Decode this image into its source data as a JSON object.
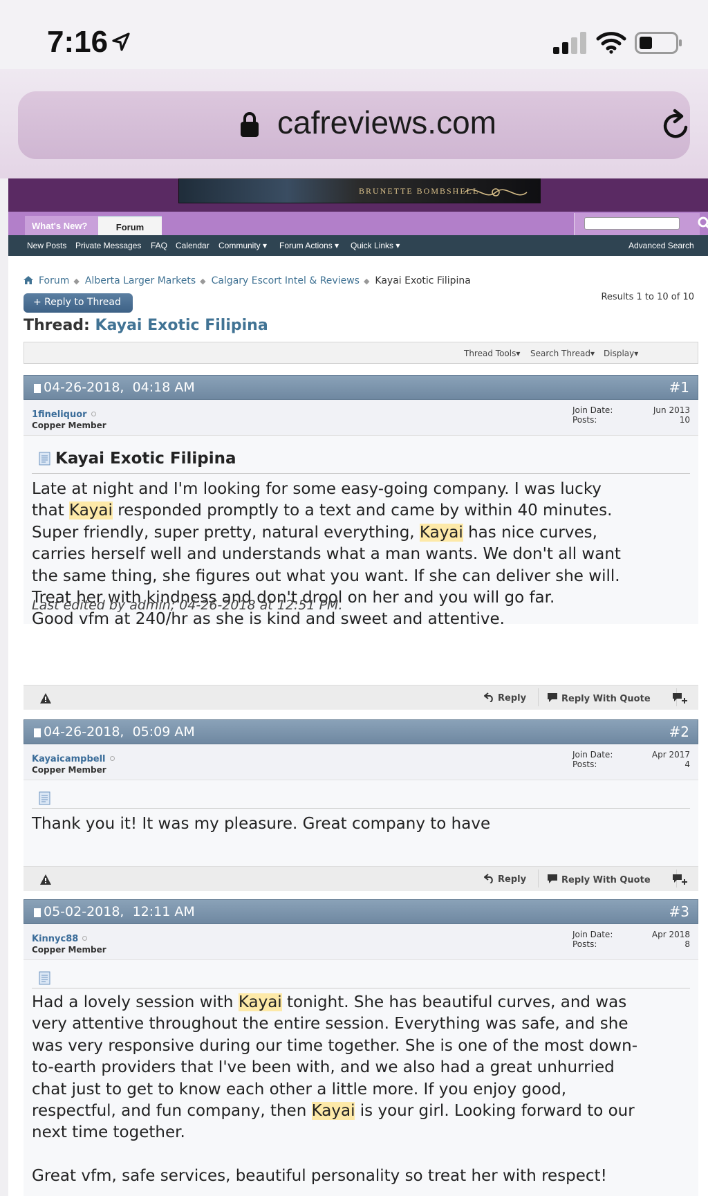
{
  "status_bar": {
    "time": "7:16",
    "icons": [
      "location-arrow-icon",
      "cellular-signal-icon",
      "wifi-icon",
      "battery-icon"
    ]
  },
  "browser": {
    "url": "cafreviews.com",
    "icons": [
      "lock-icon",
      "reload-icon"
    ]
  },
  "banner": {
    "text": "BRUNETTE BOMBSHELL"
  },
  "navbar": {
    "tabs": [
      {
        "label": "What's New?",
        "active": false
      },
      {
        "label": "Forum",
        "active": true
      }
    ],
    "search_placeholder": ""
  },
  "subnav": {
    "items": [
      "New Posts",
      "Private Messages",
      "FAQ",
      "Calendar",
      "Community ▾",
      "Forum Actions ▾",
      "Quick Links ▾"
    ],
    "advanced_search": "Advanced Search"
  },
  "breadcrumbs": [
    "Forum",
    "Alberta Larger Markets",
    "Calgary Escort Intel & Reviews",
    "Kayai Exotic Filipina"
  ],
  "reply_button": "+ Reply to Thread",
  "results": "Results 1 to 10 of 10",
  "thread": {
    "prefix": "Thread:",
    "title": "Kayai Exotic Filipina"
  },
  "tools": [
    "Thread Tools",
    "Search Thread",
    "Display"
  ],
  "post_labels": {
    "join_date": "Join Date:",
    "posts": "Posts:",
    "reply": "Reply",
    "reply_with_quote": "Reply With Quote"
  },
  "posts": [
    {
      "date": "04-26-2018,",
      "time": "04:18 AM",
      "number": "#1",
      "username": "1fineliquor",
      "rank": "Copper Member",
      "join_date": "Jun 2013",
      "post_count": "10",
      "subject": "Kayai Exotic Filipina",
      "message_lines": [
        "Late at night and I'm looking for some easy-going company. I was lucky",
        "that Kayai responded promptly to a text and came by within 40 minutes.",
        "Super friendly, super pretty, natural everything, Kayai has nice curves,",
        "carries herself well and understands what a man wants. We don't all want",
        "the same thing, she figures out what you want. If she can deliver she will.",
        "Treat her with kindness and don't drool on her and you will go far.",
        "Good vfm at 240/hr as she is kind and sweet and attentive."
      ],
      "edited": "Last edited by admin; 04-26-2018 at 12:51 PM."
    },
    {
      "date": "04-26-2018,",
      "time": "05:09 AM",
      "number": "#2",
      "username": "Kayaicampbell",
      "rank": "Copper Member",
      "join_date": "Apr 2017",
      "post_count": "4",
      "subject": "",
      "message_lines": [
        "Thank you it! It was my pleasure. Great company to have"
      ],
      "edited": ""
    },
    {
      "date": "05-02-2018,",
      "time": "12:11 AM",
      "number": "#3",
      "username": "Kinnyc88",
      "rank": "Copper Member",
      "join_date": "Apr 2018",
      "post_count": "8",
      "subject": "",
      "message_lines": [
        "Had a lovely session with Kayai tonight. She has beautiful curves, and was",
        "very attentive throughout the entire session. Everything was safe, and she",
        "was very responsive during our time together. She is one of the most down-",
        "to-earth providers that I've been with, and we also had a great unhurried",
        "chat just to get to know each other a little more. If you enjoy good,",
        "respectful, and fun company, then Kayai is your girl. Looking forward to our",
        "next time together.",
        "",
        "Great vfm, safe services, beautiful personality so treat her with respect!"
      ],
      "edited": ""
    }
  ],
  "colors": {
    "banner_purple": "#5a2a63",
    "nav_purple": "#b27fc9",
    "subnav_dark": "#2f4452",
    "post_header_blue": "#7b93aa",
    "link_blue": "#417394",
    "highlight_yellow": "#fde9a8"
  }
}
